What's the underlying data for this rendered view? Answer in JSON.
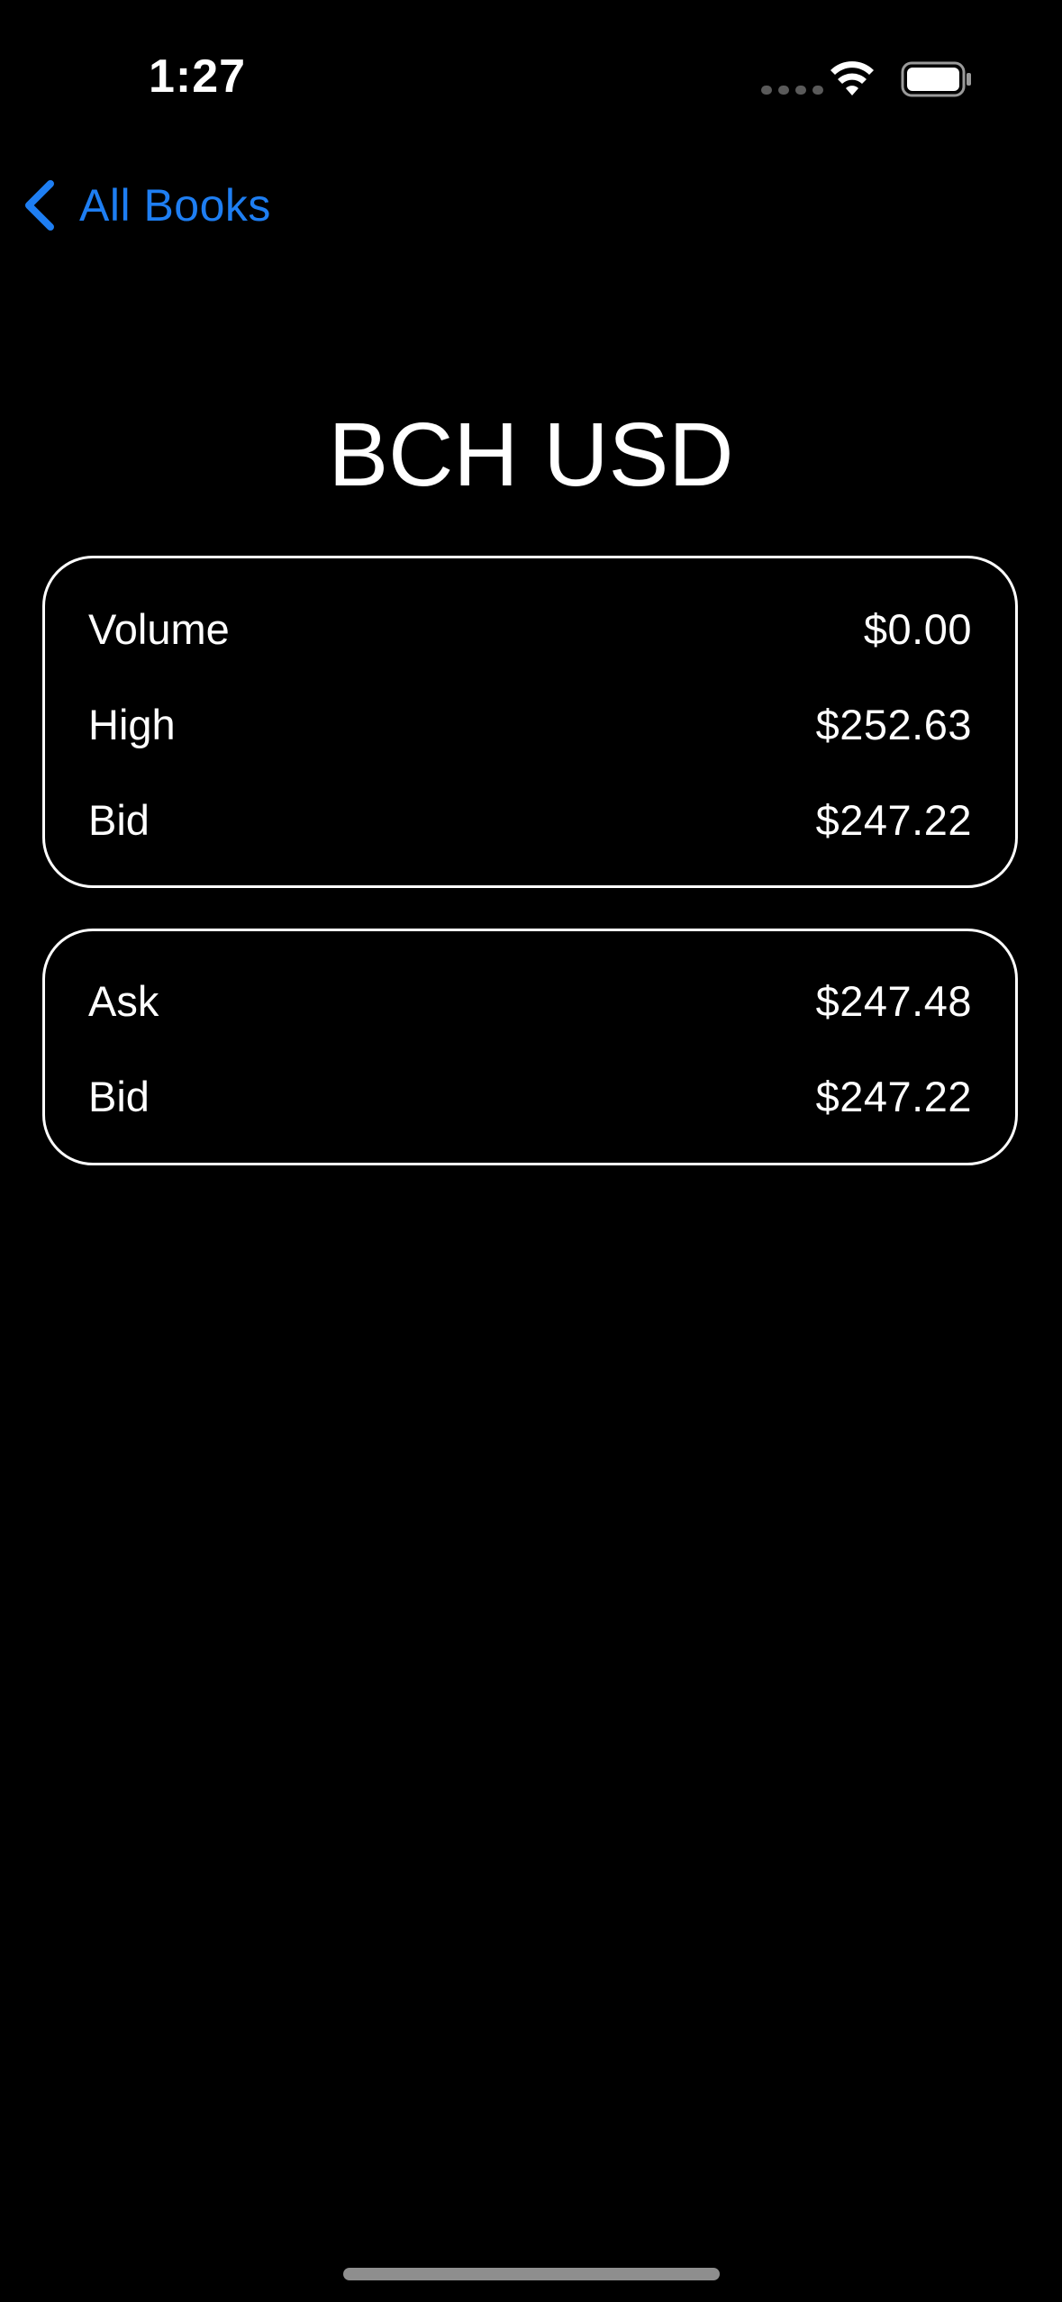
{
  "status_bar": {
    "time": "1:27",
    "icons": [
      "signal-dots-icon",
      "wifi-icon",
      "battery-icon"
    ]
  },
  "nav": {
    "back_label": "All Books",
    "back_icon": "chevron-left-icon",
    "accent_color": "#1e7ef2"
  },
  "title": "BCH USD",
  "summary_card": {
    "rows": [
      {
        "label": "Volume",
        "value": "$0.00"
      },
      {
        "label": "High",
        "value": "$252.63"
      },
      {
        "label": "Bid",
        "value": "$247.22"
      }
    ]
  },
  "book_card": {
    "rows": [
      {
        "label": "Ask",
        "value": "$247.48"
      },
      {
        "label": "Bid",
        "value": "$247.22"
      }
    ]
  }
}
